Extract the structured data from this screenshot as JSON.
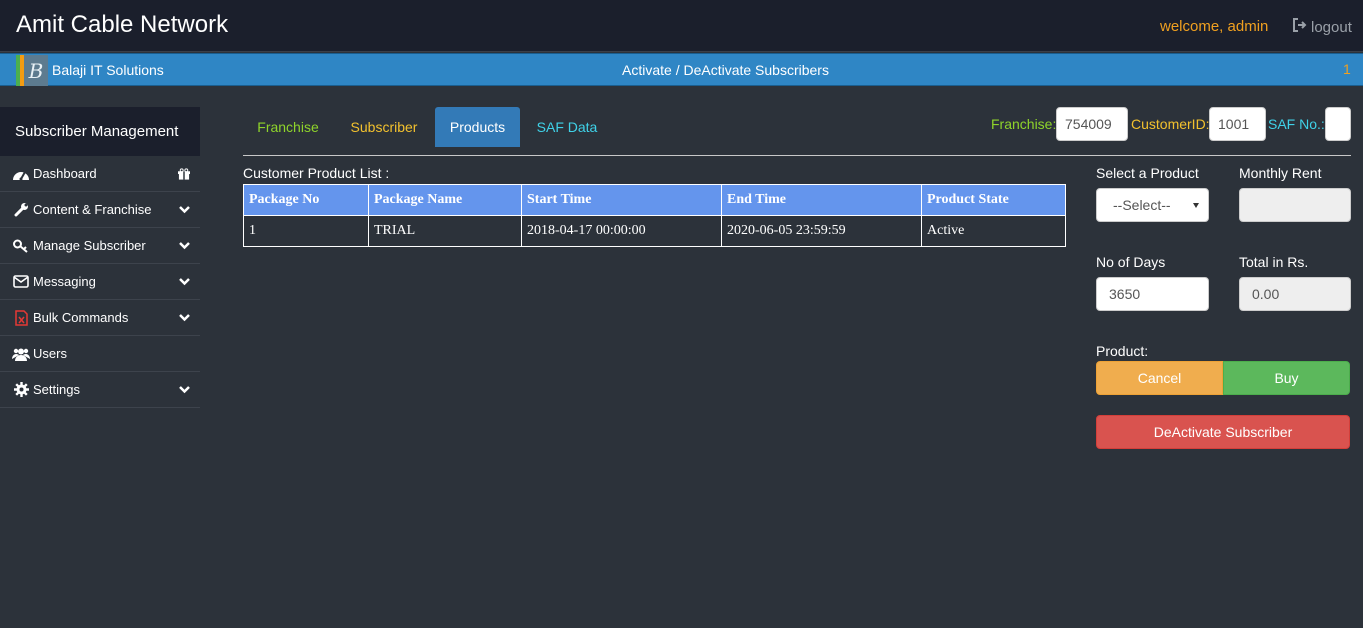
{
  "header": {
    "app_title": "Amit Cable Network",
    "welcome": "welcome, admin",
    "logout": "logout"
  },
  "bluebar": {
    "logo_letter": "B",
    "company": "Balaji IT Solutions",
    "page_title": "Activate / DeActivate Subscribers",
    "count": "1"
  },
  "sidebar": {
    "title": "Subscriber Management",
    "items": [
      {
        "label": "Dashboard"
      },
      {
        "label": "Content & Franchise"
      },
      {
        "label": "Manage Subscriber"
      },
      {
        "label": "Messaging"
      },
      {
        "label": "Bulk Commands"
      },
      {
        "label": "Users"
      },
      {
        "label": "Settings"
      }
    ]
  },
  "tabs": [
    {
      "label": "Franchise"
    },
    {
      "label": "Subscriber"
    },
    {
      "label": "Products"
    },
    {
      "label": "SAF Data"
    }
  ],
  "lookup": {
    "franchise_label": "Franchise:",
    "franchise_value": "754009",
    "customer_label": "CustomerID:",
    "customer_value": "1001",
    "saf_label": "SAF No.:",
    "saf_value": ""
  },
  "product_list": {
    "title": "Customer Product List :",
    "columns": [
      "Package No",
      "Package Name",
      "Start Time",
      "End Time",
      "Product State"
    ],
    "rows": [
      [
        "1",
        "TRIAL",
        "2018-04-17 00:00:00",
        "2020-06-05 23:59:59",
        "Active"
      ]
    ]
  },
  "form": {
    "select_product_label": "Select a Product",
    "select_product_value": "--Select--",
    "monthly_rent_label": "Monthly Rent",
    "monthly_rent_value": "",
    "days_label": "No of Days",
    "days_value": "3650",
    "total_label": "Total in Rs.",
    "total_value": "0.00",
    "product_label": "Product:",
    "cancel": "Cancel",
    "buy": "Buy",
    "deactivate": "DeActivate Subscriber"
  },
  "colors": {
    "accent_orange": "#f0a020",
    "tab_active": "#337ab7",
    "table_header": "#6495ed"
  }
}
